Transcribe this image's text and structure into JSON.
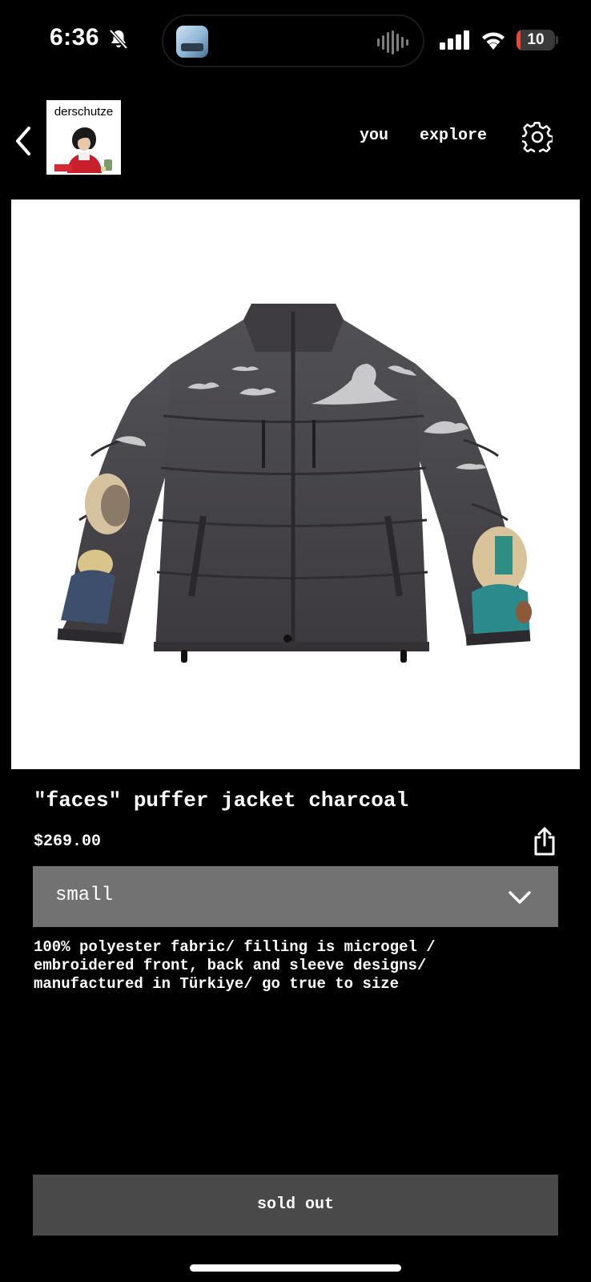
{
  "status_bar": {
    "time": "6:36",
    "battery_level": "10",
    "battery_fraction": 0.1,
    "battery_color": "#e8453c",
    "icons": [
      "bell-slash-icon",
      "cellular-signal-icon",
      "wifi-icon",
      "battery-icon"
    ]
  },
  "nav": {
    "back_icon": "chevron-left-icon",
    "store_name": "derschutze",
    "you_label": "you",
    "explore_label": "explore",
    "settings_icon": "gear-icon"
  },
  "product": {
    "title": "\"faces\" puffer jacket charcoal",
    "price": "$269.00",
    "share_icon": "share-icon",
    "size_selected": "small",
    "description_lines": [
      "100% polyester fabric/ filling is microgel /",
      "embroidered front, back and sleeve designs/",
      "manufactured in Türkiye/ go true to size"
    ],
    "cta_label": "sold out"
  },
  "colors": {
    "background": "#000000",
    "select_bg": "#727272",
    "button_bg": "#494949",
    "jacket": "#48454a"
  }
}
